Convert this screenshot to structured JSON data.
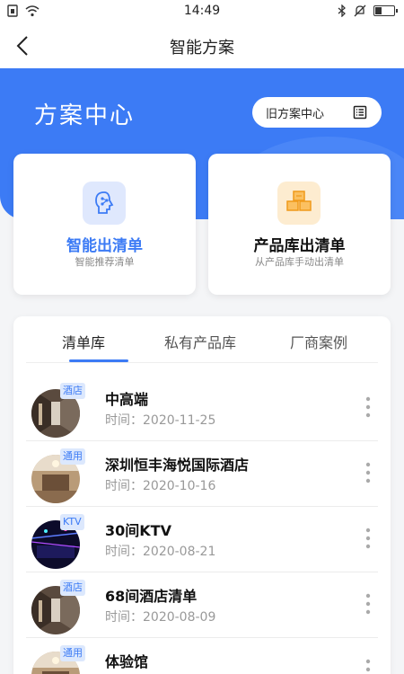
{
  "status_bar": {
    "time": "14:49",
    "battery_level": 0.3,
    "left_icons": [
      "sim-card-icon",
      "wifi-icon"
    ],
    "right_icons": [
      "bluetooth-icon",
      "bell-muted-icon",
      "battery-icon"
    ]
  },
  "nav": {
    "title": "智能方案",
    "back_icon": "chevron-left-icon"
  },
  "hero": {
    "title": "方案中心",
    "old_button_label": "旧方案中心",
    "old_button_icon": "list-document-icon"
  },
  "cards": [
    {
      "title": "智能出清单",
      "subtitle": "智能推荐清单",
      "icon": "ai-brain-icon",
      "title_color": "#3c7bf5",
      "icon_bg": "#dfe8fd"
    },
    {
      "title": "产品库出清单",
      "subtitle": "从产品库手动出清单",
      "icon": "boxes-icon",
      "title_color": "#111111",
      "icon_bg": "#fdecd0"
    }
  ],
  "tabs": [
    {
      "label": "清单库",
      "active": true
    },
    {
      "label": "私有产品库",
      "active": false
    },
    {
      "label": "厂商案例",
      "active": false
    }
  ],
  "list": [
    {
      "badge": "酒店",
      "title": "中高端",
      "time": "时间：2020-11-25",
      "thumb": "hotel-corridor"
    },
    {
      "badge": "通用",
      "title": "深圳恒丰海悦国际酒店",
      "time": "时间：2020-10-16",
      "thumb": "hotel-lobby"
    },
    {
      "badge": "KTV",
      "title": "30间KTV",
      "time": "时间：2020-08-21",
      "thumb": "ktv-room"
    },
    {
      "badge": "酒店",
      "title": "68间酒店清单",
      "time": "时间：2020-08-09",
      "thumb": "hotel-corridor"
    },
    {
      "badge": "通用",
      "title": "体验馆",
      "time": "",
      "thumb": "hotel-lobby"
    }
  ],
  "colors": {
    "accent": "#3c7bf5",
    "badge_bg": "#dce8fd"
  }
}
